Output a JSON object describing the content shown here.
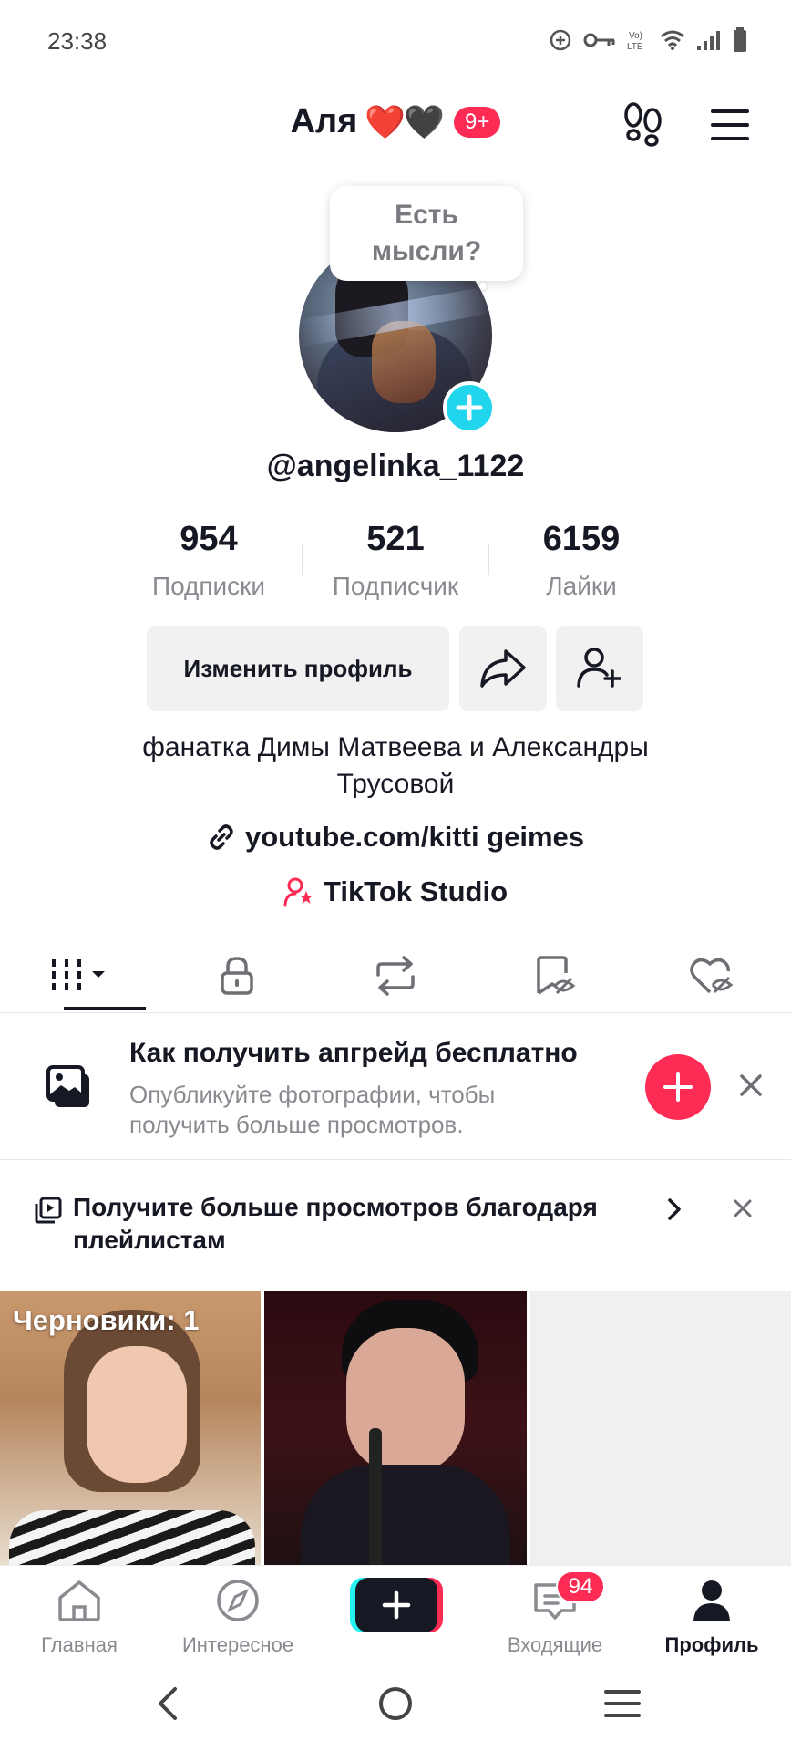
{
  "status_bar": {
    "time": "23:38"
  },
  "header": {
    "name": "Аля",
    "hearts": "❤️🖤",
    "badge": "9+"
  },
  "profile": {
    "thought_bubble": "Есть мысли?",
    "username": "@angelinka_1122",
    "stats": [
      {
        "value": "954",
        "label": "Подписки"
      },
      {
        "value": "521",
        "label": "Подписчик"
      },
      {
        "value": "6159",
        "label": "Лайки"
      }
    ],
    "edit_button": "Изменить профиль",
    "bio": "фанатка Димы Матвеева и Александры Трусовой",
    "link": "youtube.com/kitti geimes",
    "studio": "TikTok Studio"
  },
  "tabs": [
    {
      "icon": "grid-icon",
      "active": true
    },
    {
      "icon": "lock-icon",
      "active": false
    },
    {
      "icon": "repost-icon",
      "active": false
    },
    {
      "icon": "saved-hidden-icon",
      "active": false
    },
    {
      "icon": "liked-hidden-icon",
      "active": false
    }
  ],
  "promo_photo": {
    "title": "Как получить апгрейд бесплатно",
    "subtitle": "Опубликуйте фотографии, чтобы получить больше просмотров."
  },
  "promo_playlist": {
    "title": "Получите больше просмотров благодаря плейлистам"
  },
  "grid": {
    "drafts_label": "Черновики: 1"
  },
  "bottom_nav": {
    "items": [
      {
        "label": "Главная",
        "icon": "home-icon"
      },
      {
        "label": "Интересное",
        "icon": "compass-icon"
      },
      {
        "label": "",
        "icon": "plus-icon"
      },
      {
        "label": "Входящие",
        "icon": "inbox-icon"
      },
      {
        "label": "Профиль",
        "icon": "profile-icon"
      }
    ],
    "inbox_badge": "94"
  },
  "colors": {
    "accent": "#fe2c55",
    "cyan": "#20d5ec",
    "text": "#161823",
    "muted": "#8a8b91"
  }
}
